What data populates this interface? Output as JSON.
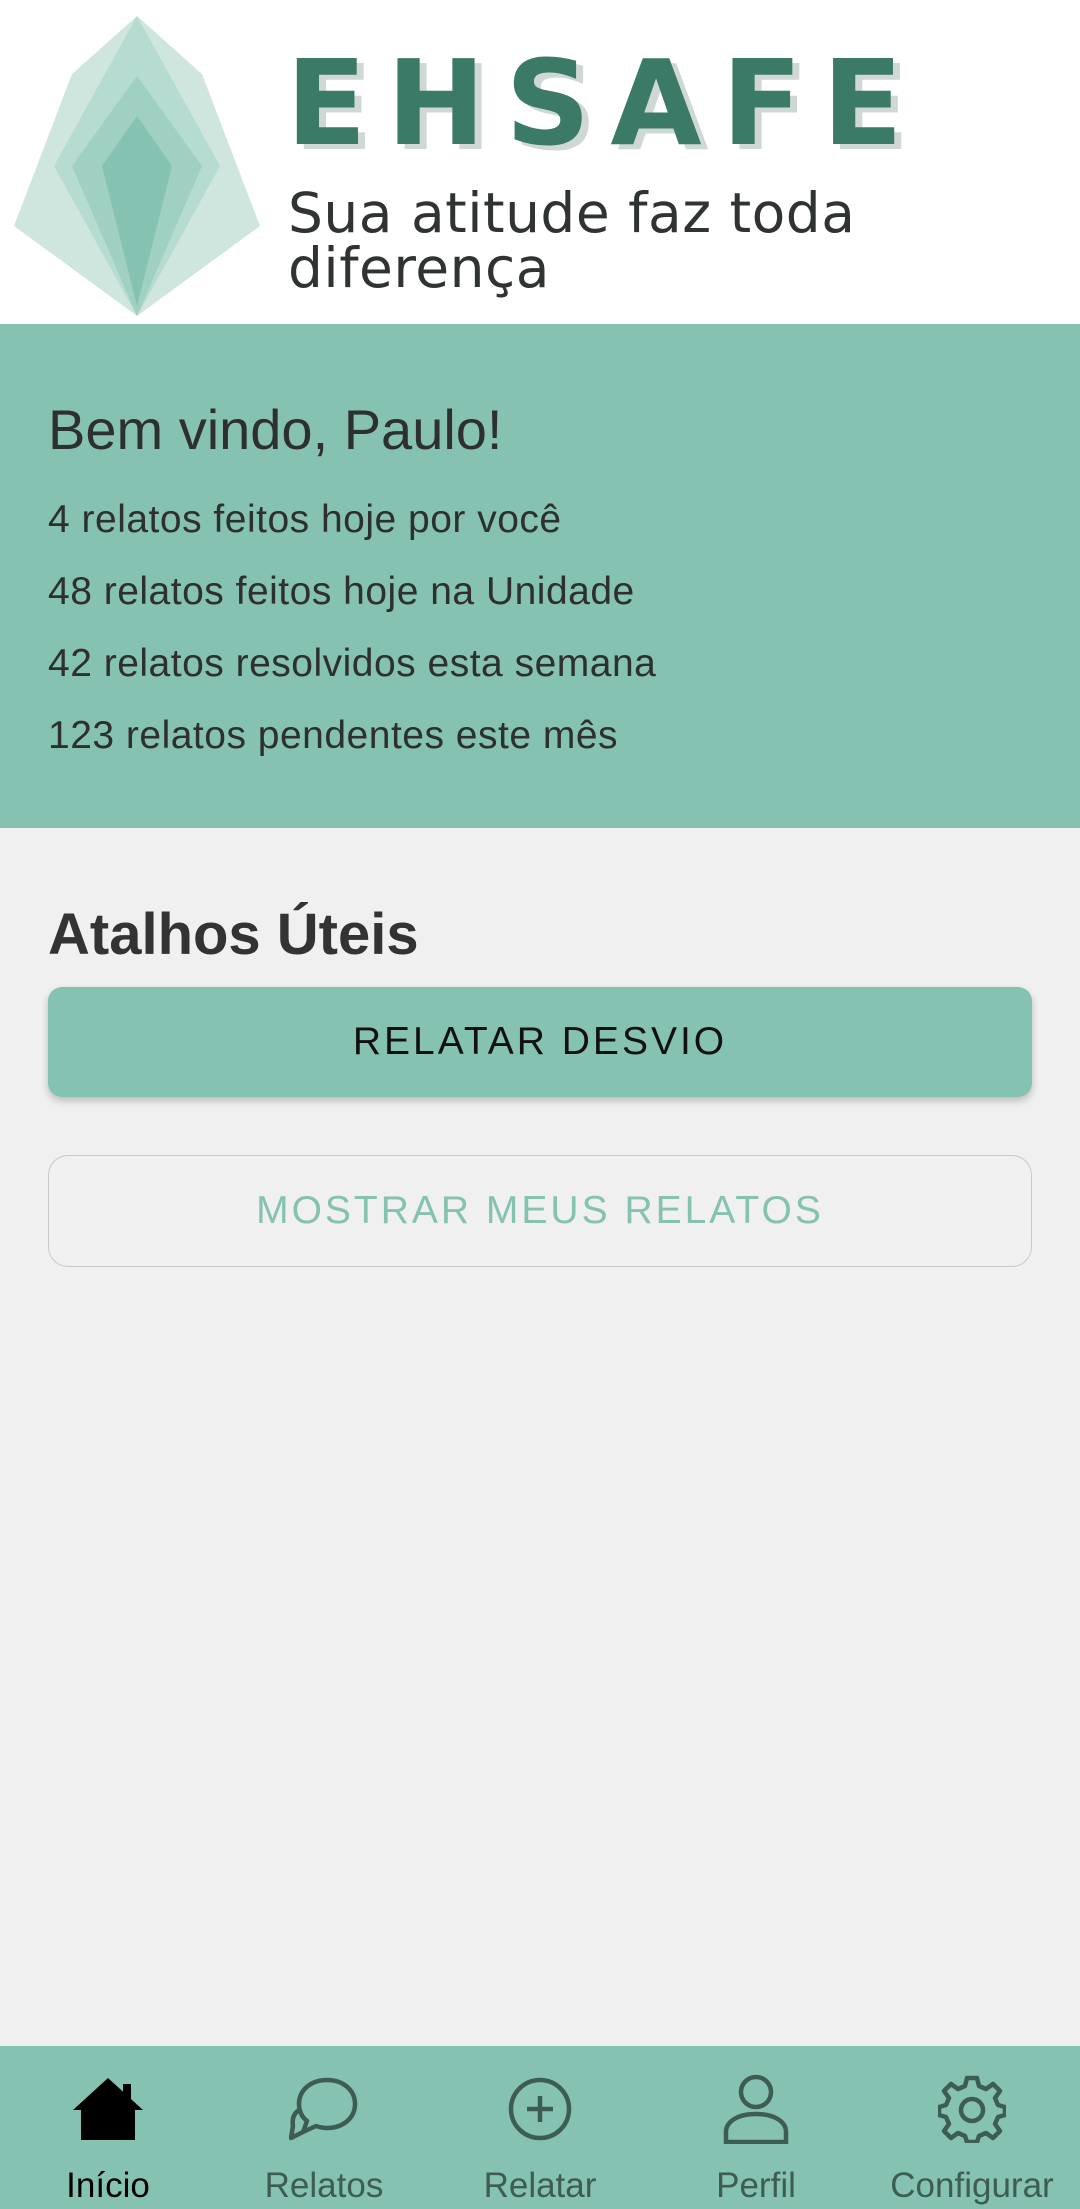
{
  "brand": {
    "name": "EHSAFE",
    "tagline": "Sua atitude faz toda diferença",
    "logo_icon": "lotus-logo-icon"
  },
  "welcome": {
    "title": "Bem vindo, Paulo!",
    "stats": [
      "4 relatos feitos hoje por você",
      "48 relatos feitos hoje na Unidade",
      "42 relatos resolvidos esta semana",
      "123 relatos pendentes este mês"
    ]
  },
  "shortcuts": {
    "title": "Atalhos Úteis",
    "primary_button": "RELATAR DESVIO",
    "secondary_button": "MOSTRAR MEUS RELATOS"
  },
  "bottom_nav": {
    "active": "Início",
    "items": [
      {
        "label": "Início",
        "icon": "home-icon"
      },
      {
        "label": "Relatos",
        "icon": "chat-bubbles-icon"
      },
      {
        "label": "Relatar",
        "icon": "add-circle-icon"
      },
      {
        "label": "Perfil",
        "icon": "person-icon"
      },
      {
        "label": "Configurar",
        "icon": "gear-icon"
      }
    ]
  },
  "colors": {
    "accent": "#86c2b2",
    "brand_text": "#3b7a66",
    "background": "#f0f0f0"
  }
}
